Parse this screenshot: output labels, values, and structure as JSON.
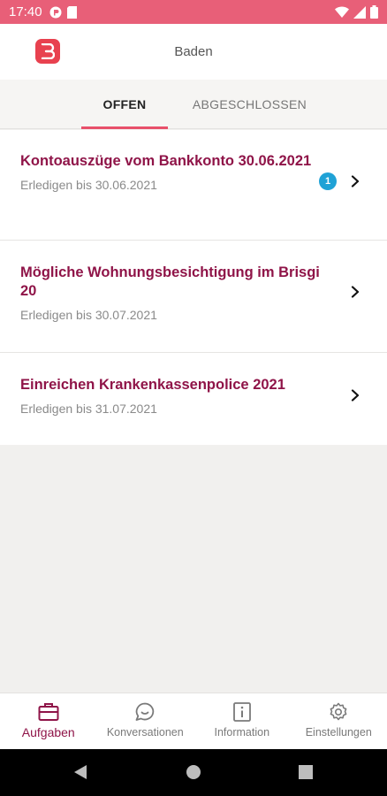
{
  "status_bar": {
    "time": "17:40",
    "left_icons": [
      "circle-app-icon",
      "sim-card-icon"
    ],
    "right_icons": [
      "wifi-icon",
      "signal-icon",
      "battery-icon"
    ]
  },
  "header": {
    "title": "Baden",
    "logo_icon": "app-logo-icon",
    "logo_color": "#e8414f"
  },
  "tabs": [
    {
      "label": "OFFEN",
      "active": true
    },
    {
      "label": "ABGESCHLOSSEN",
      "active": false
    }
  ],
  "tasks": [
    {
      "title": "Kontoauszüge vom Bankkonto 30.06.2021",
      "due": "Erledigen bis 30.06.2021",
      "badge": "1"
    },
    {
      "title": "Mögliche Wohnungsbesichtigung im Brisgi 20",
      "due": "Erledigen bis 30.07.2021",
      "badge": ""
    },
    {
      "title": "Einreichen Krankenkassenpolice 2021",
      "due": "Erledigen bis 31.07.2021",
      "badge": ""
    }
  ],
  "bottom_nav": [
    {
      "label": "Aufgaben",
      "icon": "briefcase-icon",
      "active": true
    },
    {
      "label": "Konversationen",
      "icon": "chat-bubble-icon",
      "active": false
    },
    {
      "label": "Information",
      "icon": "info-document-icon",
      "active": false
    },
    {
      "label": "Einstellungen",
      "icon": "gear-icon",
      "active": false
    }
  ],
  "colors": {
    "status_bar": "#e85f78",
    "accent": "#8f1448",
    "tab_indicator": "#e8506a",
    "badge": "#1fa2d6"
  }
}
